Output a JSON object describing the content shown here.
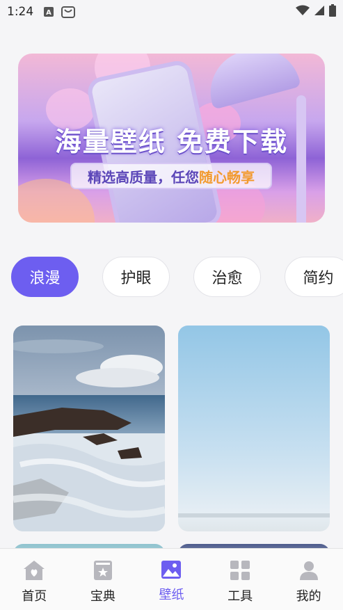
{
  "status": {
    "time": "1:24",
    "icons": [
      "a-icon",
      "bag-icon",
      "wifi-icon",
      "signal-icon",
      "battery-icon"
    ]
  },
  "banner": {
    "title": "海量壁纸 免费下载",
    "subtitle_prefix": "精选高质量，任您",
    "subtitle_highlight": "随心畅享"
  },
  "tags": [
    "浪漫",
    "护眼",
    "治愈",
    "简约"
  ],
  "active_tag": "浪漫",
  "colors": {
    "accent": "#6d5ef0",
    "highlight": "#f29a2e"
  },
  "tabbar": {
    "items": [
      {
        "label": "首页",
        "icon": "home-icon"
      },
      {
        "label": "宝典",
        "icon": "book-star-icon"
      },
      {
        "label": "壁纸",
        "icon": "image-icon",
        "active": true
      },
      {
        "label": "工具",
        "icon": "grid-icon"
      },
      {
        "label": "我的",
        "icon": "person-icon"
      }
    ]
  }
}
